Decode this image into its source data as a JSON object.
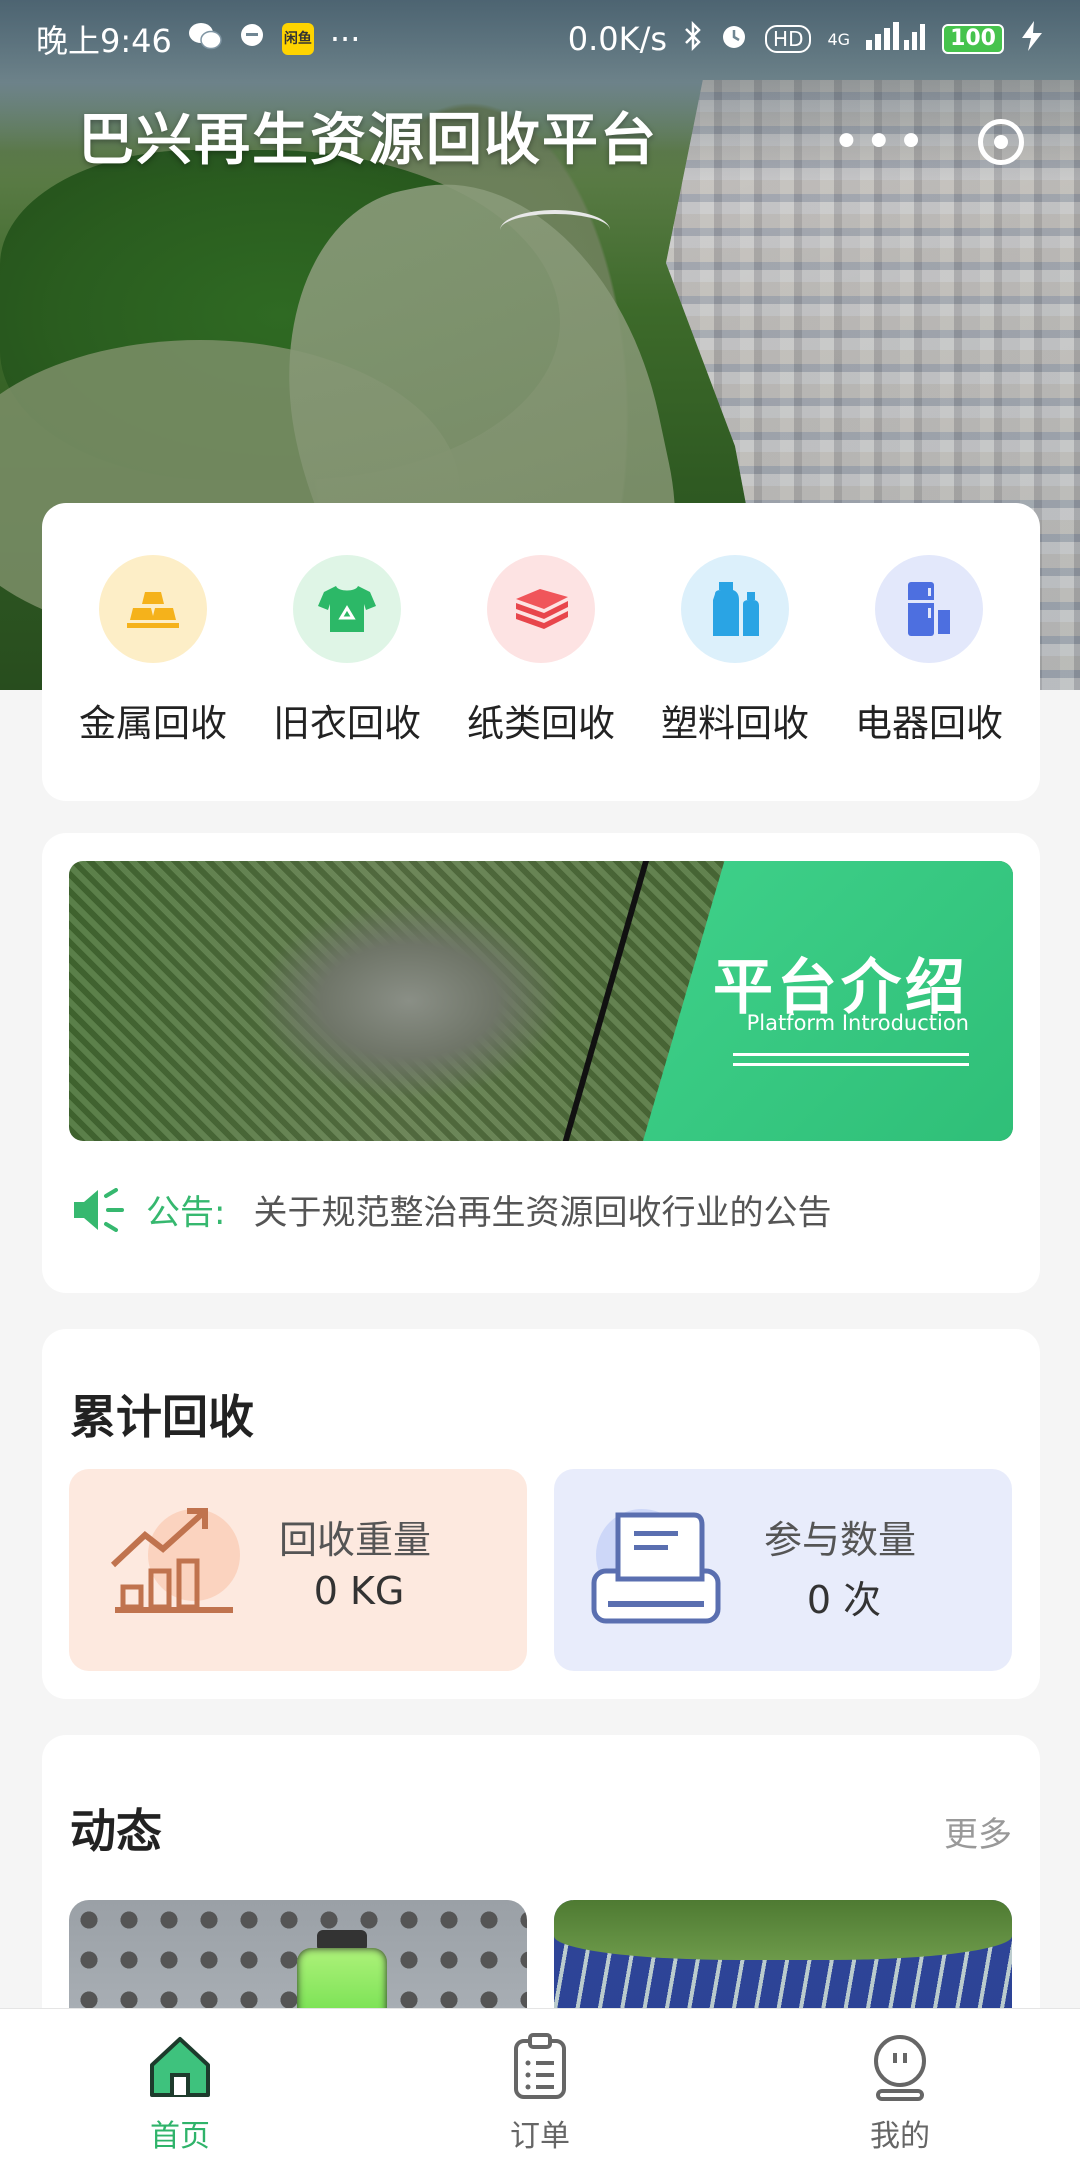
{
  "status_bar": {
    "time": "晚上9:46",
    "app_badge": "闲鱼",
    "dots": "···",
    "network_speed": "0.0K/s",
    "signal_label": "HD",
    "network_type": "4G",
    "battery": "100"
  },
  "header": {
    "title": "巴兴再生资源回收平台",
    "more_icon": "more-icon",
    "capsule_target_icon": "target-icon"
  },
  "categories": [
    {
      "label": "金属回收",
      "icon": "gold-bars-icon",
      "bg": "#fdeec7",
      "color": "#f5b21b"
    },
    {
      "label": "旧衣回收",
      "icon": "recycle-shirt-icon",
      "bg": "#dff5e6",
      "color": "#2cb867"
    },
    {
      "label": "纸类回收",
      "icon": "paper-stack-icon",
      "bg": "#fde3e3",
      "color": "#f0555a"
    },
    {
      "label": "塑料回收",
      "icon": "plastic-bottle-icon",
      "bg": "#dcf0fb",
      "color": "#2aa4e4"
    },
    {
      "label": "电器回收",
      "icon": "fridge-icon",
      "bg": "#e3e8fb",
      "color": "#4d6fe0"
    }
  ],
  "banner": {
    "title": "平台介绍",
    "subtitle": "Platform Introduction"
  },
  "notice": {
    "label": "公告:",
    "text": "关于规范整治再生资源回收行业的公告"
  },
  "stats": {
    "title": "累计回收",
    "weight": {
      "label": "回收重量",
      "value": "0 KG"
    },
    "count": {
      "label": "参与数量",
      "value": "0 次"
    }
  },
  "news": {
    "title": "动态",
    "more": "更多"
  },
  "tabbar": {
    "items": [
      {
        "label": "首页",
        "icon": "home-icon",
        "active": true
      },
      {
        "label": "订单",
        "icon": "clipboard-icon",
        "active": false
      },
      {
        "label": "我的",
        "icon": "profile-icon",
        "active": false
      }
    ]
  },
  "colors": {
    "accent": "#2fb36a",
    "notice_green": "#36b86f"
  }
}
